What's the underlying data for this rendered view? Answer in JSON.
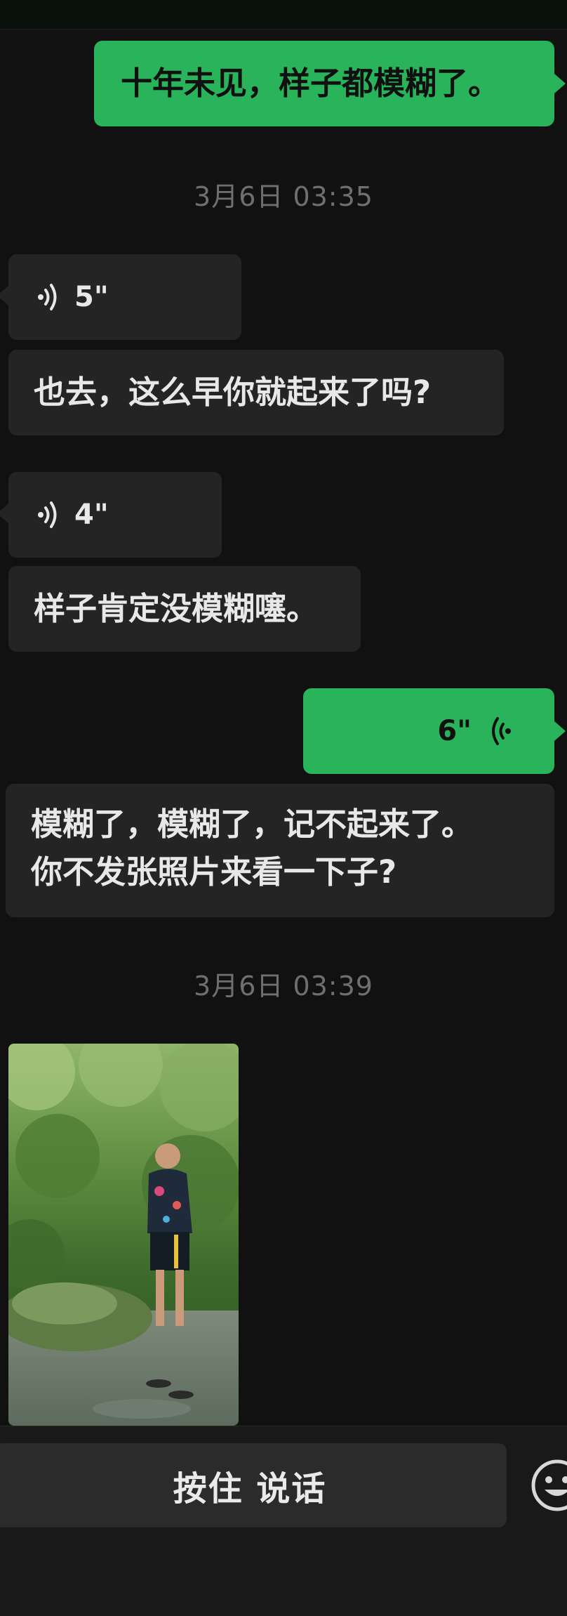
{
  "messages": {
    "m1_text": "十年未见，样子都模糊了。",
    "ts1": "3月6日 03:35",
    "voice1_duration": "5\"",
    "m2_text": "也去，这么早你就起来了吗?",
    "voice2_duration": "4\"",
    "m3_text": "样子肯定没模糊噻。",
    "voice3_duration": "6\"",
    "m4_line1": "模糊了，模糊了，记不起来了。",
    "m4_line2": "你不发张照片来看一下子?",
    "ts2": "3月6日 03:39"
  },
  "input_bar": {
    "hold_to_talk": "按住 说话",
    "emoji_icon": "smiley-face-icon"
  },
  "colors": {
    "background": "#111111",
    "outgoing_bubble": "#29b35a",
    "incoming_bubble": "#242424",
    "timestamp_text": "#6f6f6f"
  }
}
